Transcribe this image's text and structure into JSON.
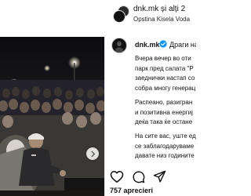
{
  "post": {
    "author_group": "dnk.mk și alți 2",
    "location": "Opstina Kisela Voda"
  },
  "caption": {
    "username": "dnk.mk",
    "first_line": "Драги наш",
    "paragraph1": [
      "Вчера вечер во оти",
      "парк пред салата \"Р",
      "заеднички настап со",
      "собра многу генерац"
    ],
    "paragraph2": [
      "Распеано, разигран",
      "и позитивна енергиј",
      "деќа така ќе остане"
    ],
    "paragraph3": [
      "На сите вас, уште ед",
      "се заблагодаруваме",
      "давате низ годините"
    ]
  },
  "likes": "757 aprecieri",
  "icons": {
    "carousel_next": "chevron-right-icon",
    "like": "heart-icon",
    "comment": "comment-icon",
    "share": "share-icon",
    "save": "bookmark-icon",
    "verified": "verified-badge-icon"
  },
  "colors": {
    "verified": "#0095f6",
    "text": "#111111"
  }
}
